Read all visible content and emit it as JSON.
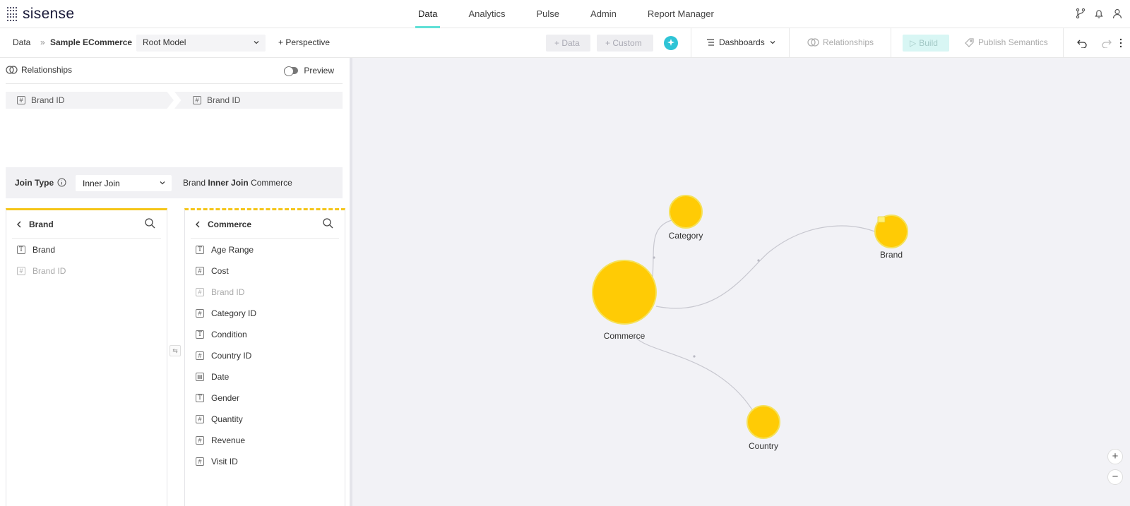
{
  "app": {
    "logo_text": "sisense"
  },
  "nav": {
    "items": [
      "Data",
      "Analytics",
      "Pulse",
      "Admin",
      "Report Manager"
    ]
  },
  "breadcrumb": {
    "root": "Data",
    "sep": "»",
    "model": "Sample ECommerce"
  },
  "toolbar": {
    "model_select": "Root Model",
    "perspective": "+ Perspective",
    "add_data": "+ Data",
    "add_custom": "+ Custom",
    "dashboards": "Dashboards",
    "relationships": "Relationships",
    "build": "Build",
    "publish": "Publish Semantics"
  },
  "relationship_panel": {
    "title": "Relationships",
    "preview": "Preview",
    "left_field": "Brand ID",
    "right_field": "Brand ID",
    "join_type_label": "Join Type",
    "join_type_value": "Inner Join",
    "join_desc_left": "Brand",
    "join_desc_mid": "Inner Join",
    "join_desc_right": "Commerce"
  },
  "brand_table": {
    "title": "Brand",
    "fields": [
      {
        "name": "Brand",
        "type": "text",
        "dim": false
      },
      {
        "name": "Brand ID",
        "type": "number",
        "dim": true
      }
    ]
  },
  "commerce_table": {
    "title": "Commerce",
    "fields": [
      {
        "name": "Age Range",
        "type": "text",
        "dim": false
      },
      {
        "name": "Cost",
        "type": "number",
        "dim": false
      },
      {
        "name": "Brand ID",
        "type": "number",
        "dim": true
      },
      {
        "name": "Category ID",
        "type": "number",
        "dim": false
      },
      {
        "name": "Condition",
        "type": "text",
        "dim": false
      },
      {
        "name": "Country ID",
        "type": "number",
        "dim": false
      },
      {
        "name": "Date",
        "type": "date",
        "dim": false
      },
      {
        "name": "Gender",
        "type": "text",
        "dim": false
      },
      {
        "name": "Quantity",
        "type": "number",
        "dim": false
      },
      {
        "name": "Revenue",
        "type": "number",
        "dim": false
      },
      {
        "name": "Visit ID",
        "type": "number",
        "dim": false
      }
    ]
  },
  "graph": {
    "nodes": [
      "Category",
      "Brand",
      "Commerce",
      "Country"
    ],
    "zoom_in": "+",
    "zoom_out": "−"
  },
  "colors": {
    "accent": "#5fe0d6",
    "node_fill": "#ffcb05",
    "node_stroke": "#f5e15a"
  }
}
